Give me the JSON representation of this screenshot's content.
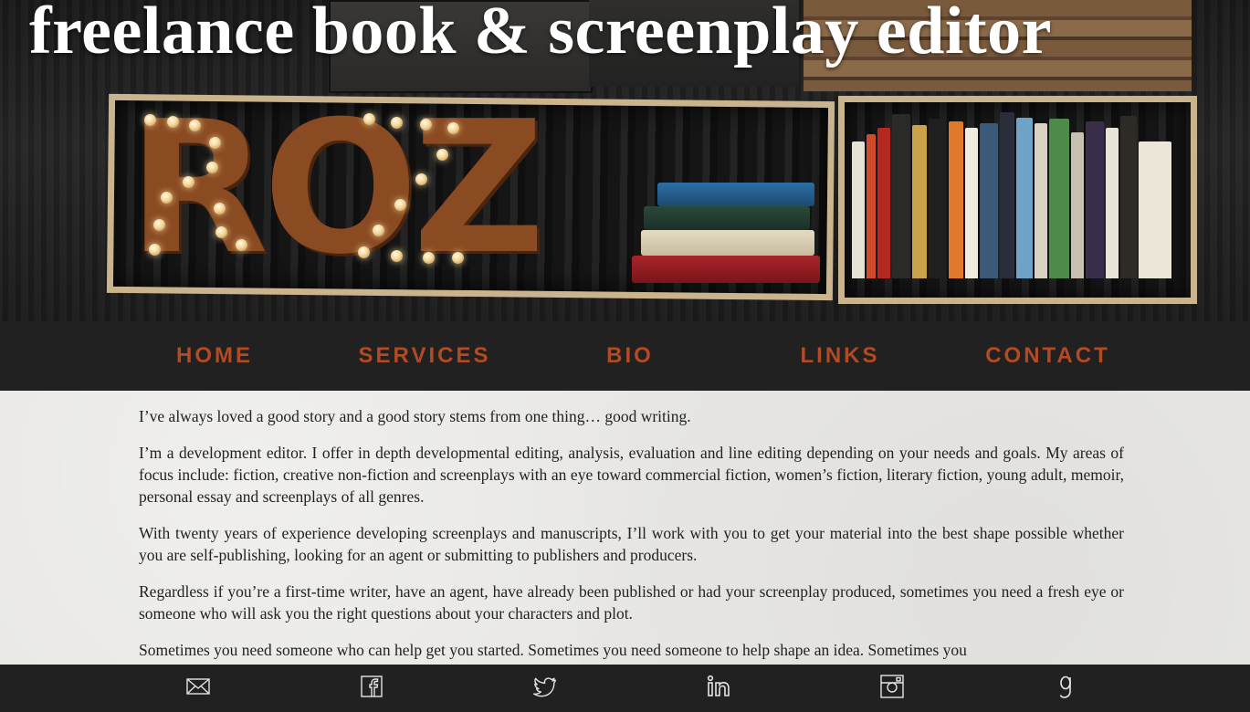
{
  "site": {
    "title": "freelance book & screenplay editor",
    "logo_text": "ROZ"
  },
  "nav": {
    "items": [
      {
        "label": "HOME"
      },
      {
        "label": "SERVICES"
      },
      {
        "label": "BIO"
      },
      {
        "label": "LINKS"
      },
      {
        "label": "CONTACT"
      }
    ]
  },
  "content": {
    "paragraphs": [
      "I’ve always loved a good story and a good story stems from one thing… good writing.",
      "I’m a development editor. I offer in depth developmental editing, analysis, evaluation and line editing depending on your needs and goals. My areas of focus include: fiction, creative non-fiction and screenplays with an eye toward commercial fiction, women’s fiction, literary fiction, young adult, memoir, personal essay and screenplays of all genres.",
      "With twenty years of experience developing screenplays and manuscripts, I’ll work with you to get your material into the best shape possible whether you are self-publishing, looking for an agent or submitting to publishers and producers.",
      "Regardless if you’re a first-time writer, have an agent, have already been published or had your screenplay produced, sometimes you need a fresh eye or someone who will ask you the right questions about your characters and plot.",
      "Sometimes you need someone who can help get you started. Sometimes you need someone to help shape an idea. Sometimes you"
    ]
  },
  "footer": {
    "icons": [
      "email-icon",
      "facebook-icon",
      "twitter-icon",
      "linkedin-icon",
      "instagram-icon",
      "goodreads-icon"
    ]
  },
  "colors": {
    "nav_text": "#b24a24",
    "nav_bg": "#222121",
    "footer_bg": "#222121",
    "content_bg": "#e8e7e3",
    "icon_stroke": "#e6e6e6"
  }
}
